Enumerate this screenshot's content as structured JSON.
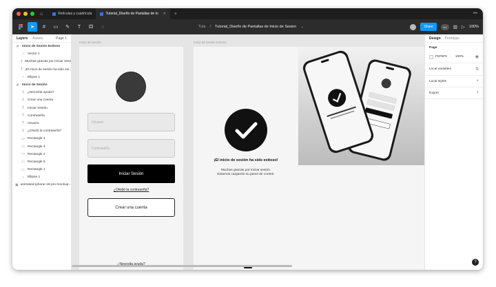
{
  "titlebar": {
    "tabs": [
      {
        "label": "Retículas y cuadrícula"
      },
      {
        "label": "Tutorial_Diseño de Pantallas de In"
      }
    ],
    "traffic": [
      "#ff5f57",
      "#febc2e",
      "#28c840"
    ]
  },
  "toolbar": {
    "project": "Tuts",
    "separator": "/",
    "file": "Tutorial_Diseño de Pantallas de Inicio de Sesion",
    "share_label": "Share",
    "zoom": "100%"
  },
  "left_panel": {
    "tabs": {
      "layers": "Layers",
      "assets": "Assets",
      "page": "Page 1"
    },
    "layers": [
      {
        "label": "Inicio de Sesión Exitoso",
        "kind": "frame",
        "level": 0,
        "glyph": "#"
      },
      {
        "label": "Vector 1",
        "kind": "vector",
        "level": 1,
        "glyph": "⟋"
      },
      {
        "label": "Muchas gracias por iniciar sesió...",
        "kind": "text",
        "level": 1,
        "glyph": "T"
      },
      {
        "label": "¡El inicio de sesión ha sido exi...",
        "kind": "text",
        "level": 1,
        "glyph": "T"
      },
      {
        "label": "Ellipse 1",
        "kind": "ellipse",
        "level": 1,
        "glyph": "○"
      },
      {
        "label": "Inicio de Sesión",
        "kind": "frame",
        "level": 0,
        "glyph": "#"
      },
      {
        "label": "¿Necesita ayuda?",
        "kind": "text",
        "level": 1,
        "glyph": "T"
      },
      {
        "label": "Crear una cuenta",
        "kind": "text",
        "level": 1,
        "glyph": "T"
      },
      {
        "label": "Iniciar Sesión",
        "kind": "text",
        "level": 1,
        "glyph": "T"
      },
      {
        "label": "Contraseña",
        "kind": "text",
        "level": 1,
        "glyph": "T"
      },
      {
        "label": "Usuario",
        "kind": "text",
        "level": 1,
        "glyph": "T"
      },
      {
        "label": "¿Olvidó la contraseña?",
        "kind": "text",
        "level": 1,
        "glyph": "T"
      },
      {
        "label": "Rectangle 4",
        "kind": "rect",
        "level": 1,
        "glyph": "▭"
      },
      {
        "label": "Rectangle 3",
        "kind": "rect",
        "level": 1,
        "glyph": "▭"
      },
      {
        "label": "Rectangle 2",
        "kind": "rect",
        "level": 1,
        "glyph": "▭"
      },
      {
        "label": "Rectangle 5",
        "kind": "rect",
        "level": 1,
        "glyph": "▭"
      },
      {
        "label": "Rectangle 1",
        "kind": "rect",
        "level": 1,
        "glyph": "▭"
      },
      {
        "label": "Ellipse 1",
        "kind": "ellipse",
        "level": 1,
        "glyph": "○"
      },
      {
        "label": "animated-iphone-15-pro-mockup-...",
        "kind": "image",
        "level": 0,
        "glyph": "▣"
      }
    ]
  },
  "canvas": {
    "frame1_label": "Inicio de Sesión",
    "frame2_label": "Inicio de Sesión Exitoso",
    "login": {
      "username_placeholder": "Usuario",
      "password_placeholder": "Contraseña",
      "login_button": "Iniciar Sesión",
      "forgot_link": "¿Olvidó la contraseña?",
      "create_account": "Crear una cuenta",
      "help_link": "¿Necesita ayuda?"
    },
    "success": {
      "title": "¡El inicio de sesión ha sido exitoso!",
      "subtitle_line1": "Muchas gracias por iniciar sesión.",
      "subtitle_line2": "Estamos cargando su panel de control."
    }
  },
  "right_panel": {
    "tabs": {
      "design": "Design",
      "prototype": "Prototype"
    },
    "page_heading": "Page",
    "page_color": "F5F5F5",
    "page_opacity": "100%",
    "local_variables": "Local variables",
    "local_styles": "Local styles",
    "export": "Export",
    "help": "?"
  }
}
